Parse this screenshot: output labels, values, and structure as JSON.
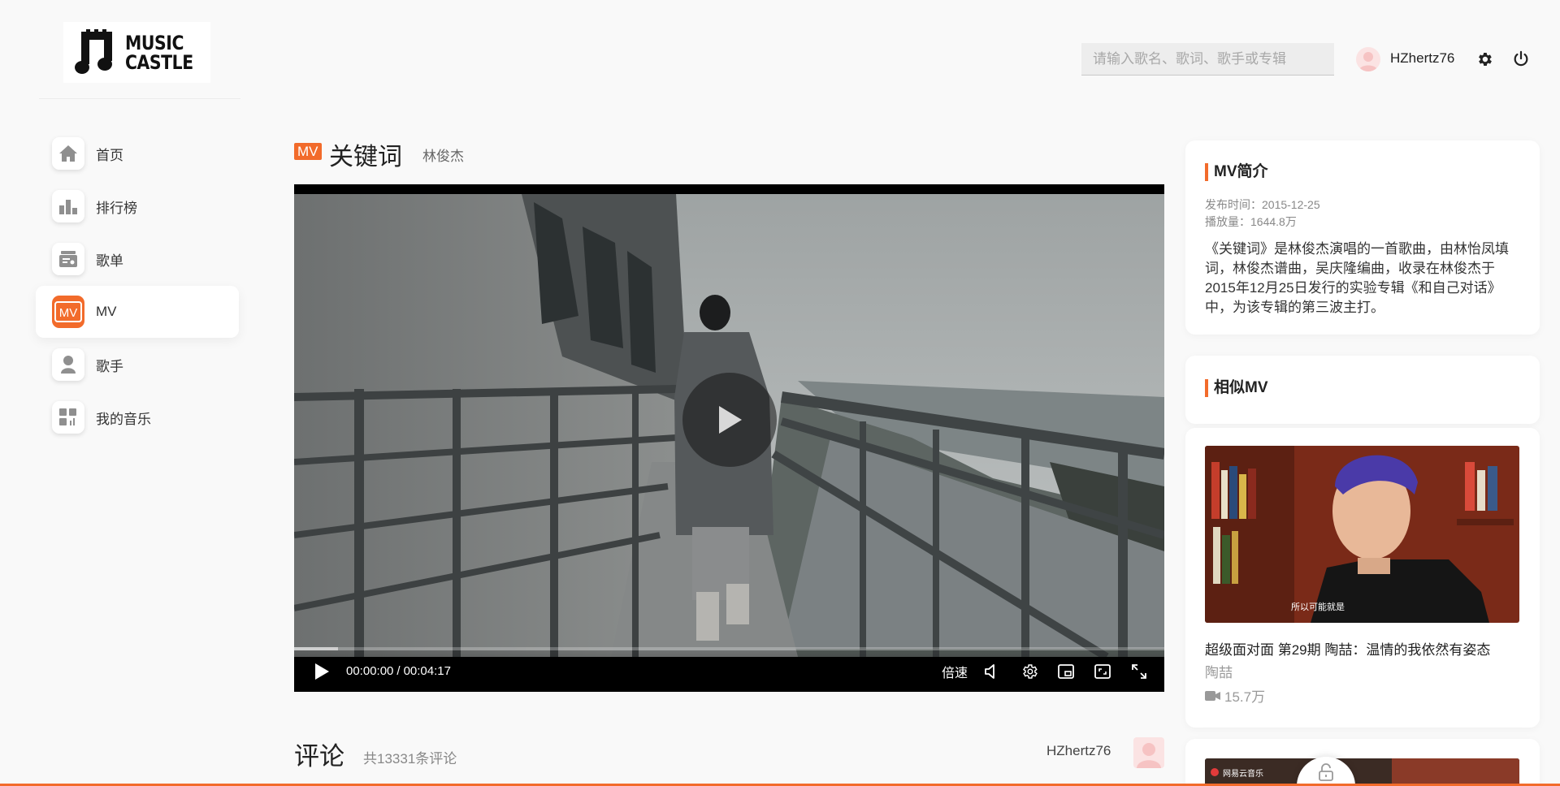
{
  "header": {
    "logo_line1": "MUSIC",
    "logo_line2": "CASTLE",
    "search_placeholder": "请输入歌名、歌词、歌手或专辑",
    "username": "HZhertz76"
  },
  "sidebar": {
    "items": [
      {
        "label": "首页",
        "icon": "home-icon",
        "active": false
      },
      {
        "label": "排行榜",
        "icon": "chart-icon",
        "active": false
      },
      {
        "label": "歌单",
        "icon": "playlist-icon",
        "active": false
      },
      {
        "label": "MV",
        "icon": "mv-icon",
        "active": true
      },
      {
        "label": "歌手",
        "icon": "singer-icon",
        "active": false
      },
      {
        "label": "我的音乐",
        "icon": "my-music-icon",
        "active": false
      }
    ]
  },
  "main": {
    "badge": "MV",
    "title": "关键词",
    "artist": "林俊杰",
    "player": {
      "current_time": "00:00:00",
      "separator": "/",
      "duration": "00:04:17",
      "speed_label": "倍速",
      "progress_fraction": 0.05
    },
    "comments": {
      "title": "评论",
      "count_text": "共13331条评论",
      "username": "HZhertz76"
    }
  },
  "intro_card": {
    "title": "MV简介",
    "publish_time": "发布时间：2015-12-25",
    "play_count": "播放量：1644.8万",
    "description": "《关键词》是林俊杰演唱的一首歌曲，由林怡凤填词，林俊杰谱曲，吴庆隆编曲，收录在林俊杰于2015年12月25日发行的实验专辑《和自己对话》中，为该专辑的第三波主打。"
  },
  "similar_card": {
    "title": "相似MV",
    "items": [
      {
        "title": "超级面对面 第29期 陶喆：温情的我依然有姿态",
        "artist": "陶喆",
        "plays": "15.7万",
        "subtitle": "所以可能就是"
      }
    ],
    "next_label": "网易云音乐"
  },
  "colors": {
    "accent": "#f26b2b",
    "background": "#f9f9f9"
  }
}
